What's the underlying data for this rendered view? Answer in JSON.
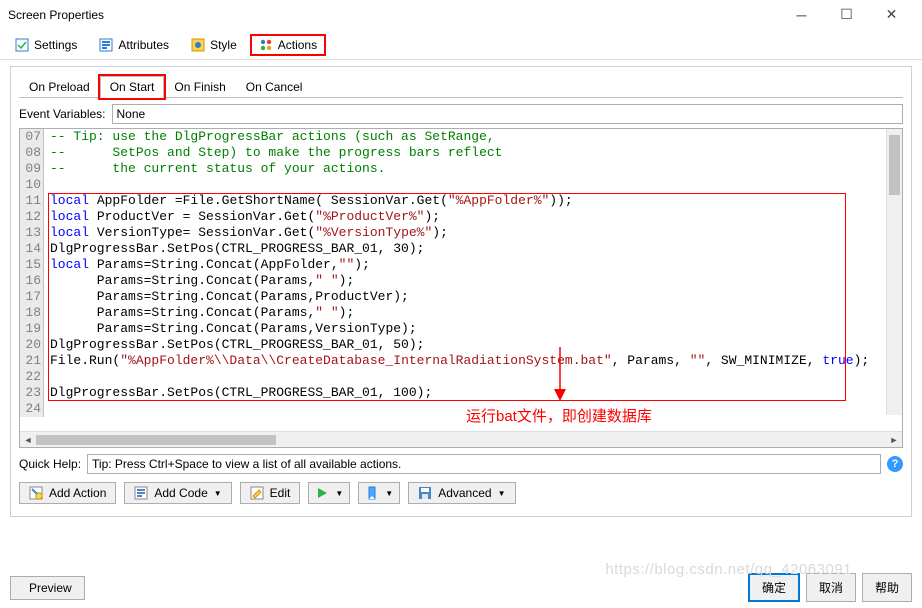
{
  "window": {
    "title": "Screen Properties"
  },
  "toolbar": {
    "settings": "Settings",
    "attributes": "Attributes",
    "style": "Style",
    "actions": "Actions"
  },
  "subtabs": {
    "on_preload": "On Preload",
    "on_start": "On Start",
    "on_finish": "On Finish",
    "on_cancel": "On Cancel"
  },
  "event_variables_label": "Event Variables:",
  "event_variables_value": "None",
  "code_lines": [
    {
      "n": "07",
      "html": "<span class='cm'>-- Tip: use the DlgProgressBar actions (such as SetRange,</span>"
    },
    {
      "n": "08",
      "html": "<span class='cm'>--      SetPos and Step) to make the progress bars reflect</span>"
    },
    {
      "n": "09",
      "html": "<span class='cm'>--      the current status of your actions.</span>"
    },
    {
      "n": "10",
      "html": ""
    },
    {
      "n": "11",
      "html": "<span class='kw'>local</span> AppFolder =File.GetShortName( SessionVar.Get(<span class='str'>\"%AppFolder%\"</span>));"
    },
    {
      "n": "12",
      "html": "<span class='kw'>local</span> ProductVer = SessionVar.Get(<span class='str'>\"%ProductVer%\"</span>);"
    },
    {
      "n": "13",
      "html": "<span class='kw'>local</span> VersionType= SessionVar.Get(<span class='str'>\"%VersionType%\"</span>);"
    },
    {
      "n": "14",
      "html": "DlgProgressBar.SetPos(CTRL_PROGRESS_BAR_01, 30);"
    },
    {
      "n": "15",
      "html": "<span class='kw'>local</span> Params=String.Concat(AppFolder,<span class='str'>\"\"</span>);"
    },
    {
      "n": "16",
      "html": "      Params=String.Concat(Params,<span class='str'>\" \"</span>);"
    },
    {
      "n": "17",
      "html": "      Params=String.Concat(Params,ProductVer);"
    },
    {
      "n": "18",
      "html": "      Params=String.Concat(Params,<span class='str'>\" \"</span>);"
    },
    {
      "n": "19",
      "html": "      Params=String.Concat(Params,VersionType);"
    },
    {
      "n": "20",
      "html": "DlgProgressBar.SetPos(CTRL_PROGRESS_BAR_01, 50);"
    },
    {
      "n": "21",
      "html": "File.Run(<span class='str'>\"%AppFolder%\\\\Data\\\\CreateDatabase_InternalRadiationSystem.bat\"</span>, Params, <span class='str'>\"\"</span>, SW_MINIMIZE, <span class='kw'>true</span>);"
    },
    {
      "n": "22",
      "html": ""
    },
    {
      "n": "23",
      "html": "DlgProgressBar.SetPos(CTRL_PROGRESS_BAR_01, 100);"
    },
    {
      "n": "24",
      "html": ""
    }
  ],
  "annotation": "运行bat文件，即创建数据库",
  "quickhelp_label": "Quick Help:",
  "quickhelp_text": "Tip: Press Ctrl+Space to view a list of all available actions.",
  "buttons": {
    "add_action": "Add Action",
    "add_code": "Add Code",
    "edit": "Edit",
    "advanced": "Advanced"
  },
  "footer": {
    "preview": "Preview",
    "ok": "确定",
    "cancel": "取消",
    "help": "帮助"
  },
  "watermark": "https://blog.csdn.net/qq_42063091"
}
